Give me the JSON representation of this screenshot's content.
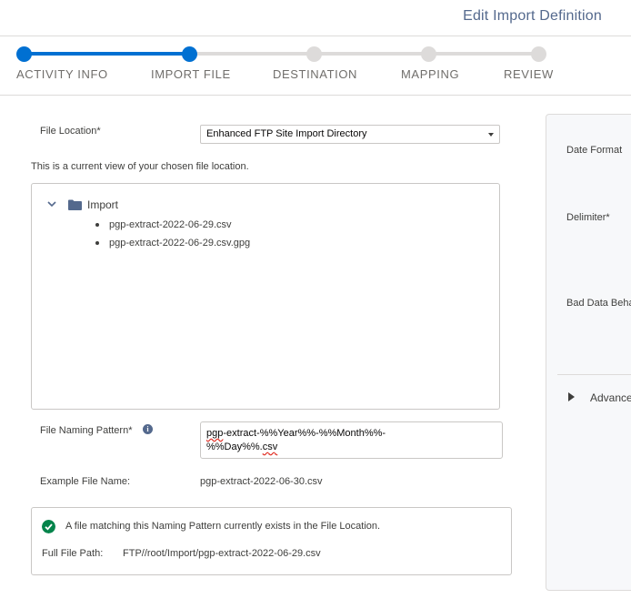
{
  "header": {
    "title": "Edit Import Definition"
  },
  "stepper": {
    "steps": [
      {
        "label": "ACTIVITY INFO",
        "state": "complete"
      },
      {
        "label": "IMPORT FILE",
        "state": "current"
      },
      {
        "label": "DESTINATION",
        "state": "incomplete"
      },
      {
        "label": "MAPPING",
        "state": "incomplete"
      },
      {
        "label": "REVIEW",
        "state": "incomplete"
      }
    ],
    "active_color": "#0070d2",
    "inactive_color": "#dddbda"
  },
  "file_location": {
    "label": "File Location*",
    "selected": "Enhanced FTP Site Import Directory"
  },
  "hint": "This is a current view of your chosen file location.",
  "tree": {
    "folder": "Import",
    "files": [
      "pgp-extract-2022-06-29.csv",
      "pgp-extract-2022-06-29.csv.gpg"
    ]
  },
  "naming_pattern": {
    "label": "File Naming Pattern*",
    "value_line1_prefix": "pgp",
    "value_line1_rest": "-extract-%%Year%%-%%Month%%-",
    "value_line2_start": "%%Day%%.",
    "value_line2_ext": "csv"
  },
  "example": {
    "label": "Example File Name:",
    "value": "pgp-extract-2022-06-30.csv"
  },
  "status": {
    "message": "A file matching this Naming Pattern currently exists in the File Location.",
    "path_label": "Full File Path:",
    "path_value": "FTP//root/Import/pgp-extract-2022-06-29.csv",
    "color": "#04844b"
  },
  "right_panel": {
    "date_format_label": "Date Format",
    "delimiter_label": "Delimiter*",
    "bad_data_label": "Bad Data Beha",
    "advanced_label": "Advance"
  }
}
